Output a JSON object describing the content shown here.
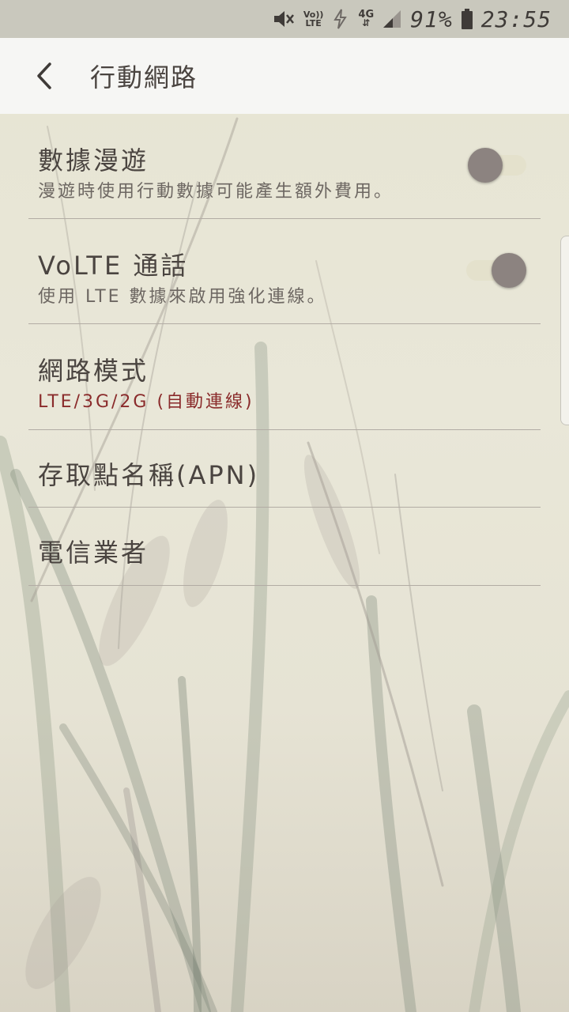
{
  "status_bar": {
    "volte_top": "Vo))",
    "volte_bottom": "LTE",
    "network_top": "4G",
    "network_arrows": "⇵",
    "battery": "91%",
    "time": "23:55",
    "icons": [
      "mute-icon",
      "volte-icon",
      "data-saver-icon",
      "4g-icon",
      "signal-icon",
      "battery-icon"
    ]
  },
  "app_bar": {
    "back_icon": "chevron-left-icon",
    "title": "行動網路"
  },
  "settings": {
    "roaming": {
      "title": "數據漫遊",
      "subtitle": "漫遊時使用行動數據可能產生額外費用。",
      "on": false
    },
    "volte": {
      "title": "VoLTE 通話",
      "subtitle": "使用 LTE 數據來啟用強化連線。",
      "on": true
    },
    "network_mode": {
      "title": "網路模式",
      "subtitle": "LTE/3G/2G (自動連線)"
    },
    "apn": {
      "title": "存取點名稱(APN)"
    },
    "carrier": {
      "title": "電信業者"
    }
  },
  "colors": {
    "accent_subtitle": "#8a2b2b",
    "toggle_thumb": "#8c8380",
    "toggle_track": "#e4e1cc",
    "status_bar_bg": "#c9c8bd",
    "app_bar_bg": "#f6f6f4"
  }
}
